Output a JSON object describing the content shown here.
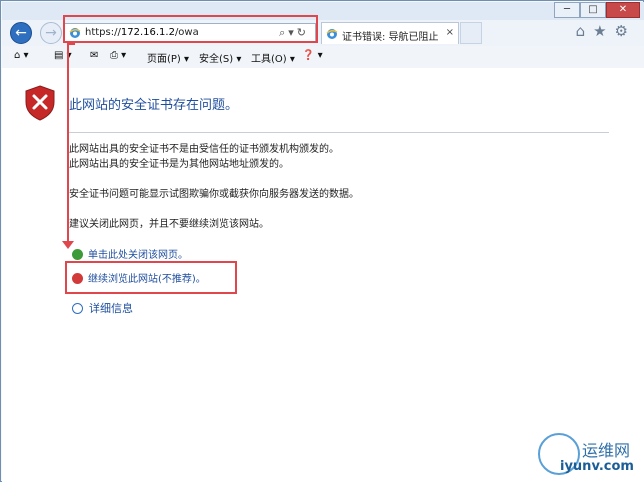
{
  "browser": {
    "url_scheme": "https://",
    "url_host": "172.16.1.2",
    "url_path": "/owa",
    "tab_title": "证书错误: 导航已阻止",
    "tab_close": "×",
    "window_min": "─",
    "window_max": "□",
    "window_close": "✕",
    "search_glyph": "⌕",
    "refresh_glyph": "↻",
    "dropdown_glyph": "▾",
    "top_icons": "⌂★⚙"
  },
  "commandbar": {
    "home": "⌂ ▾",
    "feeds": "▤ ▾",
    "mail": "✉",
    "print": "⎙ ▾",
    "page": "页面(P) ▾",
    "safety": "安全(S) ▾",
    "tools": "工具(O) ▾",
    "help": "❓ ▾"
  },
  "content": {
    "headline": "此网站的安全证书存在问题。",
    "para1_line1": "此网站出具的安全证书不是由受信任的证书颁发机构颁发的。",
    "para1_line2": "此网站出具的安全证书是为其他网站地址颁发的。",
    "para2": "安全证书问题可能显示试图欺骗你或截获你向服务器发送的数据。",
    "para3": "建议关闭此网页，并且不要继续浏览该网站。",
    "link_close": "单击此处关闭该网页。",
    "link_continue": "继续浏览此网站(不推荐)。",
    "more_info": "详细信息"
  },
  "watermark": {
    "cn": "运维网",
    "url": "iyunv.com"
  },
  "colors": {
    "accent": "#1f4e9e",
    "annotation_red": "#e0474d"
  }
}
